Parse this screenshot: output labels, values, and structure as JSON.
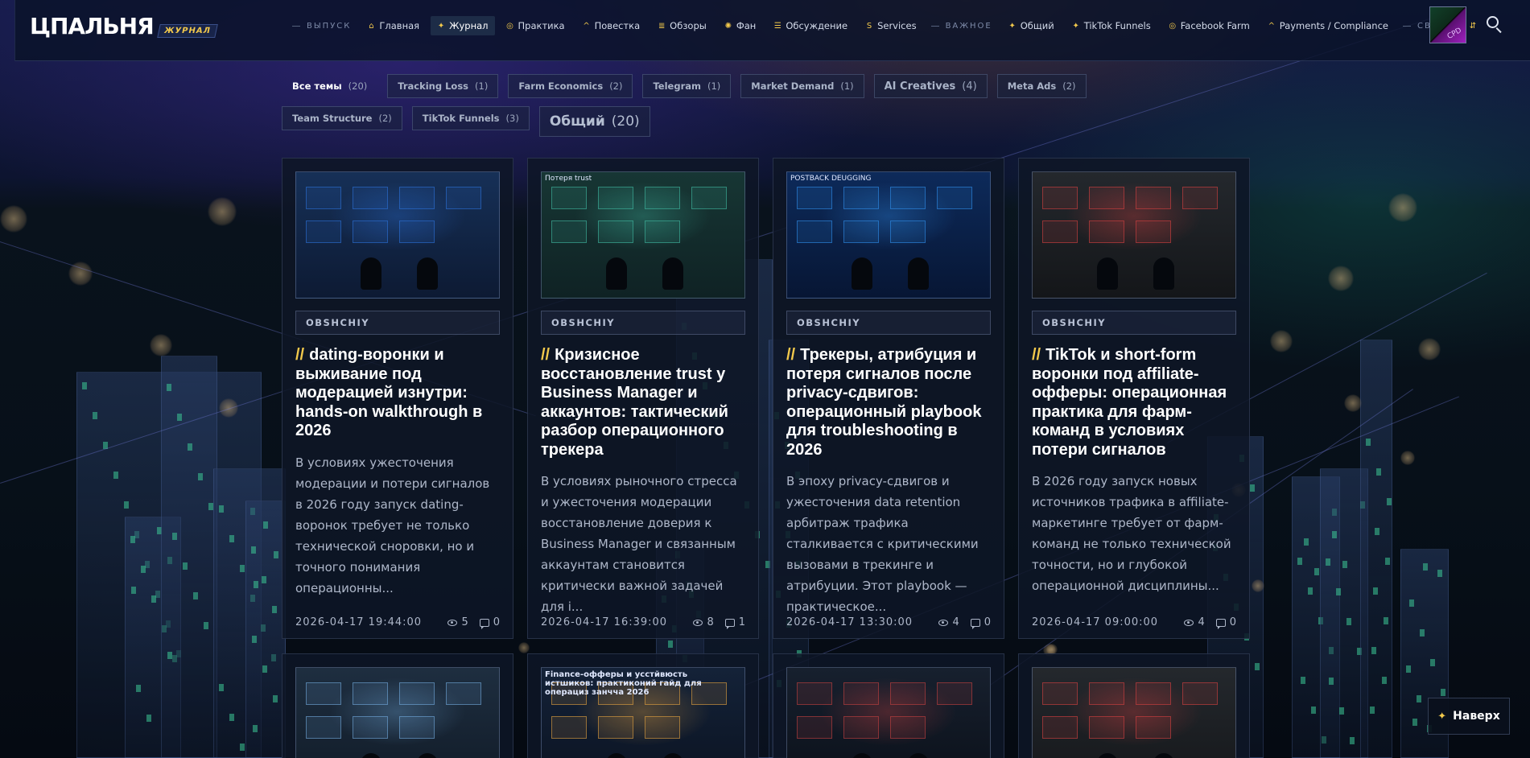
{
  "header": {
    "logo_text": "ЦПАЛЬНЯ",
    "logo_badge": "ЖУРНАЛ",
    "sections": {
      "release": "ВЫПУСК",
      "important": "ВАЖНОЕ",
      "contact": "СВЯЗЬ"
    },
    "nav_release": [
      {
        "label": "Главная",
        "icon": "home-icon",
        "glyph": "⌂"
      },
      {
        "label": "Журнал",
        "icon": "sparkle-icon",
        "glyph": "✦",
        "active": true
      },
      {
        "label": "Практика",
        "icon": "target-icon",
        "glyph": "◎"
      },
      {
        "label": "Повестка",
        "icon": "caret-icon",
        "glyph": "^"
      },
      {
        "label": "Обзоры",
        "icon": "stack-icon",
        "glyph": "≣"
      },
      {
        "label": "Фан",
        "icon": "sun-icon",
        "glyph": "✺"
      },
      {
        "label": "Обсуждение",
        "icon": "list-icon",
        "glyph": "☰"
      },
      {
        "label": "Services",
        "icon": "dollar-icon",
        "glyph": "S"
      }
    ],
    "nav_important": [
      {
        "label": "Общий",
        "icon": "sparkle-icon",
        "glyph": "✦"
      },
      {
        "label": "TikTok Funnels",
        "icon": "sparkle-icon",
        "glyph": "✦"
      },
      {
        "label": "Facebook Farm",
        "icon": "target-icon",
        "glyph": "◎"
      },
      {
        "label": "Payments / Compliance",
        "icon": "caret-icon",
        "glyph": "^"
      }
    ],
    "nav_contact": [
      {
        "label": "",
        "icon": "telegram-icon",
        "glyph": "⇵"
      }
    ],
    "avatar_text": "CPD"
  },
  "filters": [
    {
      "label": "Все темы",
      "count": "(20)",
      "style": "all"
    },
    {
      "label": "Tracking Loss",
      "count": "(1)"
    },
    {
      "label": "Farm Economics",
      "count": "(2)"
    },
    {
      "label": "Telegram",
      "count": "(1)"
    },
    {
      "label": "Market Demand",
      "count": "(1)"
    },
    {
      "label": "AI Creatives",
      "count": "(4)",
      "style": "big"
    },
    {
      "label": "Meta Ads",
      "count": "(2)"
    },
    {
      "label": "Team Structure",
      "count": "(2)"
    },
    {
      "label": "TikTok Funnels",
      "count": "(3)"
    },
    {
      "label": "Общий",
      "count": "(20)",
      "style": "xl"
    }
  ],
  "cards": [
    {
      "tag": "OBSHCHIY",
      "title": "dating-воронки и выживание под модерацией изнутри: hands-on walkthrough в 2026",
      "excerpt": "В условиях ужесточения модерации и потери сигналов в 2026 году запуск dating-воронок требует не только технической сноровки, но и точного понимания операционны...",
      "date": "2026-04-17 19:44:00",
      "views": "5",
      "comments": "0",
      "thumb_caption": "",
      "thumb_theme": "blue"
    },
    {
      "tag": "OBSHCHIY",
      "title": "Кризисное восстановление trust у Business Manager и аккаунтов: тактический разбор операционного трекера",
      "excerpt": "В условиях рыночного стресса и ужесточения модерации восстановление доверия к Business Manager и связанным аккаунтам становится критически важной задачей для i...",
      "date": "2026-04-17 16:39:00",
      "views": "8",
      "comments": "1",
      "thumb_caption": "Потеря trust",
      "thumb_theme": "teal"
    },
    {
      "tag": "OBSHCHIY",
      "title": "Трекеры, атрибуция и потеря сигналов после privacy-сдвигов: операционный playbook для troubleshooting в 2026",
      "excerpt": "В эпоху privacy-сдвигов и ужесточения data retention арбитраж трафика сталкивается с критическими вызовами в трекинге и атрибуции. Этот playbook — практическое...",
      "date": "2026-04-17 13:30:00",
      "views": "4",
      "comments": "0",
      "thumb_caption": "POSTBACK DEUGGING",
      "thumb_theme": "navy"
    },
    {
      "tag": "OBSHCHIY",
      "title": "TikTok и short-form воронки под affiliate-офферы: операционная практика для фарм-команд в условиях потери сигналов",
      "excerpt": "В 2026 году запуск новых источников трафика в affiliate-маркетинге требует от фарм-команд не только технической точности, но и глубокой операционной дисциплины...",
      "date": "2026-04-17 09:00:00",
      "views": "4",
      "comments": "0",
      "thumb_caption": "",
      "thumb_theme": "gray"
    }
  ],
  "cards_row2": [
    {
      "thumb_caption": "",
      "thumb_theme": "steel"
    },
    {
      "thumb_caption": "Finance-офферы и усстйвюсть истшиков: практиконий гайд для операциз занчча 2026",
      "thumb_theme": "dark"
    },
    {
      "thumb_caption": "",
      "thumb_theme": "map"
    },
    {
      "thumb_caption": "",
      "thumb_theme": "gray"
    }
  ],
  "back_to_top": {
    "label": "Наверх",
    "icon": "sparkle-icon",
    "glyph": "✦"
  },
  "colors": {
    "accent": "#f2c94c",
    "background": "#060b14",
    "card": "#0e1626",
    "text": "#ffffff",
    "muted": "#aeb7c9"
  }
}
